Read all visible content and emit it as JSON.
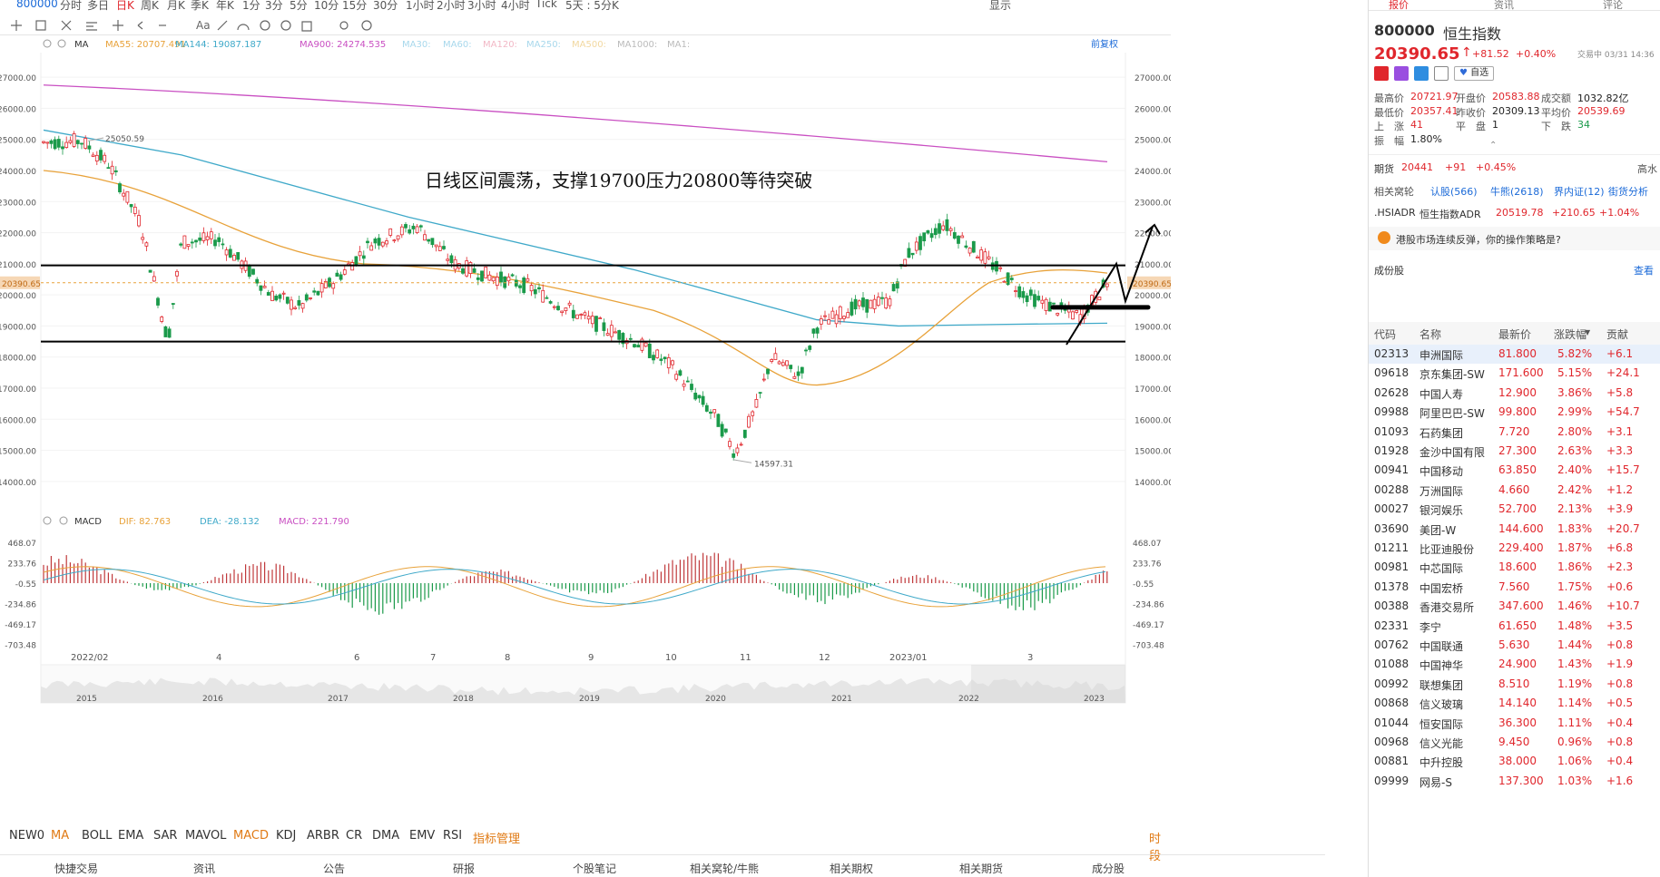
{
  "toolbar": {
    "symbol": "800000",
    "periods": [
      "分时",
      "多日",
      "日K",
      "周K",
      "月K",
      "季K",
      "年K",
      "1分",
      "3分",
      "5分",
      "10分",
      "15分",
      "30分",
      "1小时",
      "2小时",
      "3小时",
      "4小时",
      "Tick",
      "5天 : 5分K"
    ],
    "active_period": "日K",
    "right_items": [
      "显示"
    ]
  },
  "chart": {
    "ma_legend": {
      "label": "MA",
      "items": [
        {
          "text": "MA55: 20707.491",
          "color": "#e8a23a"
        },
        {
          "text": "MA144: 19087.187",
          "color": "#3fa9c9"
        },
        {
          "text": "MA900: 24274.535",
          "color": "#c94fc2"
        },
        {
          "text": "MA30:",
          "color": "#a8d8ec"
        },
        {
          "text": "MA60:",
          "color": "#a8d8ec"
        },
        {
          "text": "MA120:",
          "color": "#f2b8c6"
        },
        {
          "text": "MA250:",
          "color": "#a8d8ec"
        },
        {
          "text": "MA500:",
          "color": "#f2d8a0"
        },
        {
          "text": "MA1000:",
          "color": "#bbbbbb"
        },
        {
          "text": "MA1:",
          "color": "#bbbbbb"
        }
      ],
      "right_label": "前复权"
    },
    "y_ticks": [
      "27000.00",
      "26000.00",
      "25000.00",
      "24000.00",
      "23000.00",
      "22000.00",
      "21000.00",
      "20000.00",
      "19000.00",
      "18000.00",
      "17000.00",
      "16000.00",
      "15000.00",
      "14000.00"
    ],
    "current_price_tag": "20390.65",
    "annotation": "日线区间震荡，支撑19700压力20800等待突破",
    "high_label": "25050.59",
    "low_label": "14597.31",
    "x_ticks": [
      "2022/02",
      "4",
      "6",
      "7",
      "8",
      "9",
      "10",
      "11",
      "12",
      "2023/01",
      "3"
    ],
    "macd_legend": {
      "label": "MACD",
      "dif": "DIF: 82.763",
      "dea": "DEA: -28.132",
      "macd": "MACD: 221.790"
    },
    "macd_ticks": [
      "468.07",
      "233.76",
      "-0.55",
      "-234.86",
      "-469.17",
      "-703.48"
    ],
    "overview_years": [
      "2015",
      "2016",
      "2017",
      "2018",
      "2019",
      "2020",
      "2021",
      "2022",
      "2023"
    ]
  },
  "indicators": {
    "items": [
      "NEW0",
      "MA",
      "BOLL",
      "EMA",
      "SAR",
      "MAVOL",
      "MACD",
      "KDJ",
      "ARBR",
      "CR",
      "DMA",
      "EMV",
      "RSI",
      "指标管理"
    ],
    "active": [
      "MA",
      "MACD"
    ],
    "right": "时段"
  },
  "bottom_tabs": [
    "快捷交易",
    "资讯",
    "公告",
    "研报",
    "个股笔记",
    "相关窝轮/牛熊",
    "相关期权",
    "相关期货",
    "成分股"
  ],
  "quote": {
    "top_tabs": [
      "报价",
      "资讯",
      "评论"
    ],
    "code": "800000",
    "name": "恒生指数",
    "price": "20390.65",
    "change": "+81.52",
    "change_pct": "+0.40%",
    "status": "交易中 03/31 14:36",
    "fav_label": "自选",
    "rows": [
      [
        {
          "k": "最高价",
          "v": "20721.97",
          "c": "red"
        },
        {
          "k": "开盘价",
          "v": "20583.88",
          "c": "red"
        },
        {
          "k": "成交额",
          "v": "1032.82亿",
          "c": "dark"
        }
      ],
      [
        {
          "k": "最低价",
          "v": "20357.41",
          "c": "red"
        },
        {
          "k": "昨收价",
          "v": "20309.13",
          "c": "dark"
        },
        {
          "k": "平均价",
          "v": "20539.69",
          "c": "red"
        }
      ],
      [
        {
          "k": "上　涨",
          "v": "41",
          "c": "red"
        },
        {
          "k": "平　盘",
          "v": "1",
          "c": "dark"
        },
        {
          "k": "下　跌",
          "v": "34",
          "c": "green"
        }
      ],
      [
        {
          "k": "振　幅",
          "v": "1.80%",
          "c": "dark"
        }
      ]
    ],
    "futures": {
      "label": "期货",
      "price": "20441",
      "chg": "+91",
      "pct": "+0.45%",
      "right": "高水"
    },
    "warrants": {
      "label": "相关窝轮",
      "items": [
        "认股(566)",
        "牛熊(2618)",
        "界内证(12)",
        "街货分析"
      ]
    },
    "adr": {
      "code": ".HSIADR",
      "name": "恒生指数ADR",
      "price": "20519.78",
      "chg": "+210.65",
      "pct": "+1.04%"
    },
    "prompt": "港股市场连续反弹，你的操作策略是?"
  },
  "constituents": {
    "title": "成份股",
    "more": "查看",
    "headers": [
      "代码",
      "名称",
      "最新价",
      "涨跌幅",
      "贡献"
    ],
    "rows": [
      [
        "02313",
        "申洲国际",
        "81.800",
        "5.82%",
        "+6.1"
      ],
      [
        "09618",
        "京东集团-SW",
        "171.600",
        "5.15%",
        "+24.1"
      ],
      [
        "02628",
        "中国人寿",
        "12.900",
        "3.86%",
        "+5.8"
      ],
      [
        "09988",
        "阿里巴巴-SW",
        "99.800",
        "2.99%",
        "+54.7"
      ],
      [
        "01093",
        "石药集团",
        "7.720",
        "2.80%",
        "+3.1"
      ],
      [
        "01928",
        "金沙中国有限",
        "27.300",
        "2.63%",
        "+3.3"
      ],
      [
        "00941",
        "中国移动",
        "63.850",
        "2.40%",
        "+15.7"
      ],
      [
        "00288",
        "万洲国际",
        "4.660",
        "2.42%",
        "+1.2"
      ],
      [
        "00027",
        "银河娱乐",
        "52.700",
        "2.13%",
        "+3.9"
      ],
      [
        "03690",
        "美团-W",
        "144.600",
        "1.83%",
        "+20.7"
      ],
      [
        "01211",
        "比亚迪股份",
        "229.400",
        "1.87%",
        "+6.8"
      ],
      [
        "00981",
        "中芯国际",
        "18.600",
        "1.86%",
        "+2.3"
      ],
      [
        "01378",
        "中国宏桥",
        "7.560",
        "1.75%",
        "+0.6"
      ],
      [
        "00388",
        "香港交易所",
        "347.600",
        "1.46%",
        "+10.7"
      ],
      [
        "02331",
        "李宁",
        "61.650",
        "1.48%",
        "+3.5"
      ],
      [
        "00762",
        "中国联通",
        "5.630",
        "1.44%",
        "+0.8"
      ],
      [
        "01088",
        "中国神华",
        "24.900",
        "1.43%",
        "+1.9"
      ],
      [
        "00992",
        "联想集团",
        "8.510",
        "1.19%",
        "+0.8"
      ],
      [
        "00868",
        "信义玻璃",
        "14.140",
        "1.14%",
        "+0.5"
      ],
      [
        "01044",
        "恒安国际",
        "36.300",
        "1.11%",
        "+0.4"
      ],
      [
        "00968",
        "信义光能",
        "9.450",
        "0.96%",
        "+0.8"
      ],
      [
        "00881",
        "中升控股",
        "38.000",
        "1.06%",
        "+0.4"
      ],
      [
        "09999",
        "网易-S",
        "137.300",
        "1.03%",
        "+1.6"
      ]
    ]
  }
}
